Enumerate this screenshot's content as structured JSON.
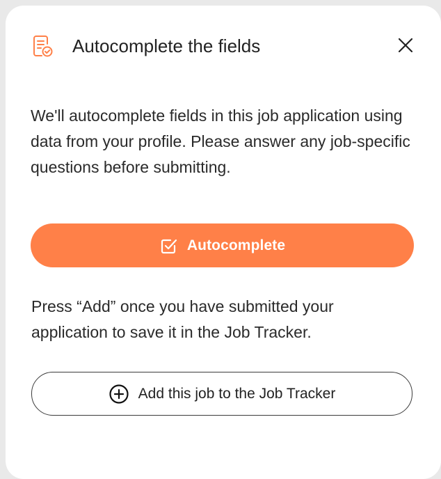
{
  "dialog": {
    "title": "Autocomplete the fields",
    "description": "We'll autocomplete fields in this job application using data from your profile. Please answer any job-specific questions before submitting.",
    "primary_button": {
      "label": "Autocomplete",
      "icon": "checkbox-edit-icon"
    },
    "note": "Press “Add” once you have submitted your application to save it in the Job Tracker.",
    "secondary_button": {
      "label": "Add this job to the Job Tracker",
      "icon": "plus-circle-icon"
    },
    "header_icon": "document-check-icon",
    "close_icon": "close-icon"
  },
  "colors": {
    "accent": "#ff8048",
    "text": "#2a2a2a",
    "panel_bg": "#ffffff",
    "outer_bg": "#e9e9e9"
  }
}
